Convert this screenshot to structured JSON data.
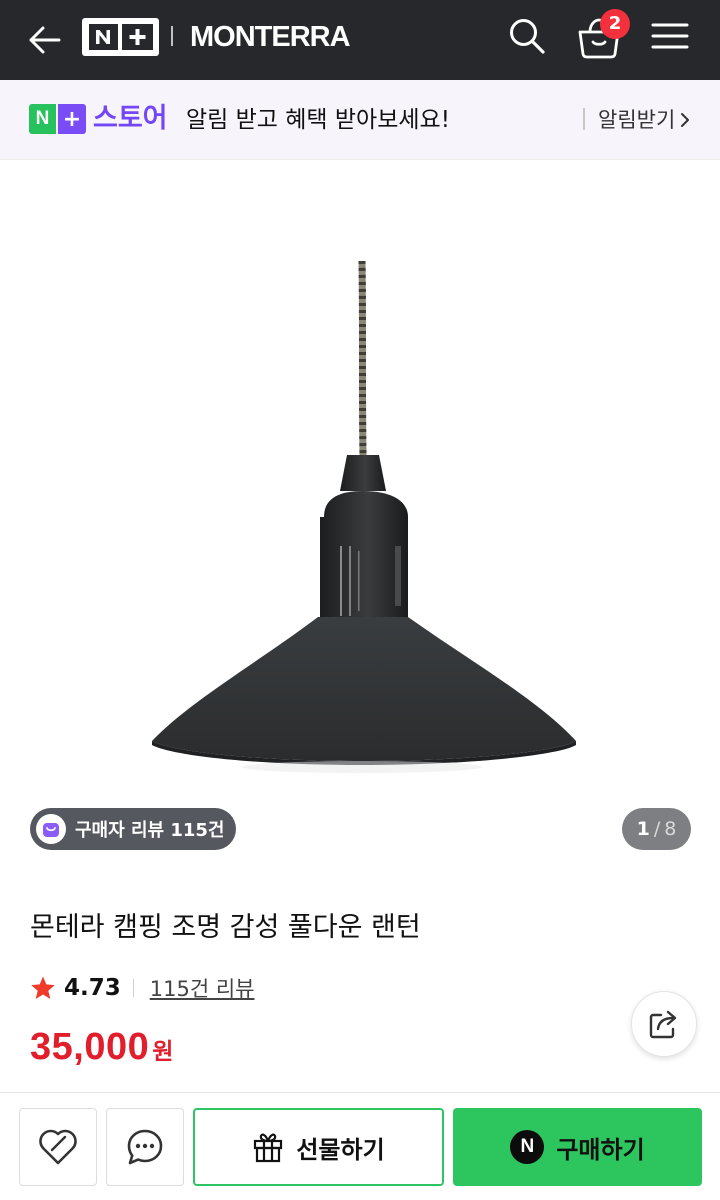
{
  "header": {
    "brand_logo": "N+",
    "brand_name": "MONTERRA",
    "cart_count": "2",
    "icons": [
      "back-arrow-icon",
      "search-icon",
      "cart-basket-icon",
      "hamburger-menu-icon"
    ]
  },
  "notice": {
    "store_logo": "N+",
    "store_word": "스토어",
    "message": "알림 받고 혜택 받아보세요!",
    "action_label": "알림받기"
  },
  "gallery": {
    "review_badge": "구매자 리뷰 115건",
    "current_page": "1",
    "page_separator": "/",
    "total_pages": "8"
  },
  "product": {
    "title": "몬테라 캠핑 조명 감성 풀다운 랜턴",
    "rating": "4.73",
    "review_link": "115건 리뷰",
    "price": "35,000",
    "price_unit": "원"
  },
  "actions": {
    "gift_label": "선물하기",
    "buy_label": "구매하기",
    "npay_mark": "N"
  },
  "colors": {
    "topbar": "#26282b",
    "accent_green": "#2cc55e",
    "accent_purple": "#7347f6",
    "price_red": "#e01e2c",
    "badge_red": "#f5303d"
  }
}
